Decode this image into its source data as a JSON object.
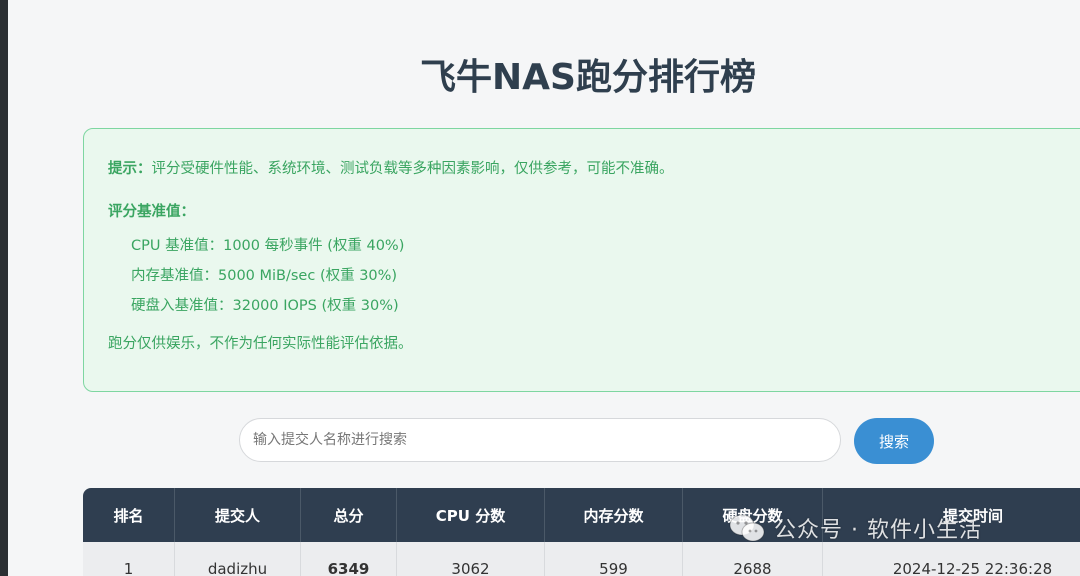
{
  "title": "飞牛NAS跑分排行榜",
  "notice": {
    "tip_label": "提示：",
    "tip_text": "评分受硬件性能、系统环境、测试负载等多种因素影响，仅供参考，可能不准确。",
    "base_title": "评分基准值：",
    "base_items": [
      "CPU 基准值：1000 每秒事件 (权重 40%)",
      "内存基准值：5000 MiB/sec (权重 30%)",
      "硬盘入基准值：32000 IOPS (权重 30%)"
    ],
    "footer": "跑分仅供娱乐，不作为任何实际性能评估依据。"
  },
  "search": {
    "placeholder": "输入提交人名称进行搜索",
    "value": "",
    "button_label": "搜索"
  },
  "table": {
    "headers": [
      "排名",
      "提交人",
      "总分",
      "CPU 分数",
      "内存分数",
      "硬盘分数",
      "提交时间"
    ],
    "rows": [
      [
        "1",
        "dadizhu",
        "6349",
        "3062",
        "599",
        "2688",
        "2024-12-25 22:36:28"
      ]
    ]
  },
  "watermark": "公众号 · 软件小生活",
  "colors": {
    "accent": "#3a8fd3",
    "notice_text": "#3aa561",
    "notice_bg": "#eaf8ee",
    "table_header": "#2f3e50"
  }
}
